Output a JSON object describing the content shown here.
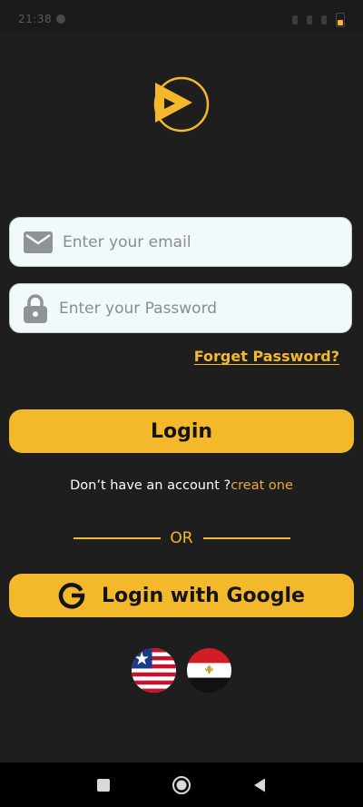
{
  "status_bar": {
    "time": "21:38"
  },
  "brand": {
    "accent_color": "#f4b82b",
    "logo_icon": "play-logo-icon"
  },
  "login_form": {
    "email": {
      "placeholder": "Enter your email",
      "value": "",
      "icon": "mail-icon"
    },
    "password": {
      "placeholder": "Enter your Password",
      "value": "",
      "icon": "lock-icon"
    },
    "forget_password_label": "Forget Password?",
    "login_button_label": "Login"
  },
  "signup": {
    "prompt": "Don’t have an account ?",
    "link_label": "creat one"
  },
  "divider": {
    "label": "OR"
  },
  "google_login": {
    "label": "Login with Google",
    "icon": "google-g-icon"
  },
  "languages": {
    "flags": [
      "liberia-flag-icon",
      "egypt-flag-icon"
    ]
  },
  "navigation_bar": {
    "buttons": [
      "recent-apps-icon",
      "home-icon",
      "back-icon"
    ]
  }
}
